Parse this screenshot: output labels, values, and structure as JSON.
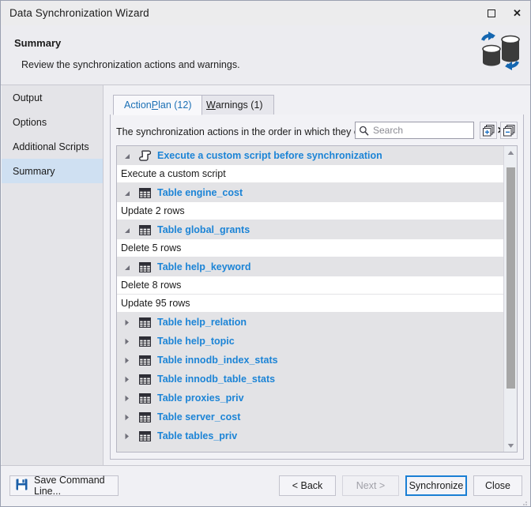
{
  "window": {
    "title": "Data Synchronization Wizard",
    "maximize_label": "maximize-icon",
    "close_label": "✕"
  },
  "header": {
    "title": "Summary",
    "subtitle": "Review the synchronization actions and warnings.",
    "brand_icon": "database-sync-icon"
  },
  "sidebar": {
    "items": [
      {
        "label": "Output",
        "selected": false
      },
      {
        "label": "Options",
        "selected": false
      },
      {
        "label": "Additional Scripts",
        "selected": false
      },
      {
        "label": "Summary",
        "selected": true
      }
    ]
  },
  "main": {
    "tabs": [
      {
        "label": "Action Plan (12)",
        "pre": "Action ",
        "mnemonic": "P",
        "post": "lan (12)",
        "active": true
      },
      {
        "label": "Warnings (1)",
        "pre": "",
        "mnemonic": "W",
        "post": "arnings (1)",
        "active": false
      }
    ],
    "description": "The synchronization actions in the order in which they occur.",
    "search": {
      "placeholder": "Search",
      "value": "",
      "clear_label": "✕",
      "icon": "search-icon"
    },
    "toolbar": {
      "expand_all_label": "expand-all-icon",
      "collapse_all_label": "collapse-all-icon"
    },
    "action_plan": [
      {
        "label": "Execute a custom script before synchronization",
        "icon": "script-icon",
        "expanded": true,
        "children": [
          "Execute a custom script"
        ]
      },
      {
        "label": "Table engine_cost",
        "icon": "table-icon",
        "expanded": true,
        "children": [
          "Update 2 rows"
        ]
      },
      {
        "label": "Table global_grants",
        "icon": "table-icon",
        "expanded": true,
        "children": [
          "Delete 5 rows"
        ]
      },
      {
        "label": "Table help_keyword",
        "icon": "table-icon",
        "expanded": true,
        "children": [
          "Delete 8 rows",
          "Update 95 rows"
        ]
      },
      {
        "label": "Table help_relation",
        "icon": "table-icon",
        "expanded": false,
        "children": []
      },
      {
        "label": "Table help_topic",
        "icon": "table-icon",
        "expanded": false,
        "children": []
      },
      {
        "label": "Table innodb_index_stats",
        "icon": "table-icon",
        "expanded": false,
        "children": []
      },
      {
        "label": "Table innodb_table_stats",
        "icon": "table-icon",
        "expanded": false,
        "children": []
      },
      {
        "label": "Table proxies_priv",
        "icon": "table-icon",
        "expanded": false,
        "children": []
      },
      {
        "label": "Table server_cost",
        "icon": "table-icon",
        "expanded": false,
        "children": []
      },
      {
        "label": "Table tables_priv",
        "icon": "table-icon",
        "expanded": false,
        "children": []
      }
    ],
    "scrollbar": {
      "thumb_top_pct": 3,
      "thumb_height_pct": 79
    }
  },
  "footer": {
    "save_command_line": "Save Command Line...",
    "save_icon": "floppy-save-icon",
    "back": "< Back",
    "next": "Next >",
    "synchronize": "Synchronize",
    "close": "Close"
  },
  "colors": {
    "link_blue": "#1c84d6",
    "accent_blue": "#1a7fd4",
    "selection_blue": "#cfe0f2",
    "window_bg": "#f0f0f4",
    "list_group_bg": "#e3e3e6",
    "list_child_bg": "#ffffff"
  }
}
